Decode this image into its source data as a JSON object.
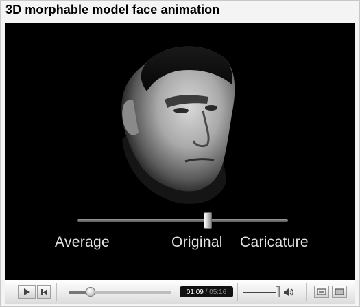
{
  "title": "3D morphable model face animation",
  "video": {
    "slider_labels": {
      "left": "Average",
      "middle": "Original",
      "right": "Caricature"
    },
    "morph_slider_position": 0.6
  },
  "controls": {
    "play_icon": "play-icon",
    "rewind_icon": "skip-to-start-icon",
    "progress_fraction": 0.21,
    "current_time": "01:09",
    "time_separator": " / ",
    "total_time": "05:16",
    "volume_fraction": 0.9,
    "volume_icon": "speaker-icon",
    "view_icons": [
      "normal-size-icon",
      "fullscreen-icon"
    ]
  }
}
